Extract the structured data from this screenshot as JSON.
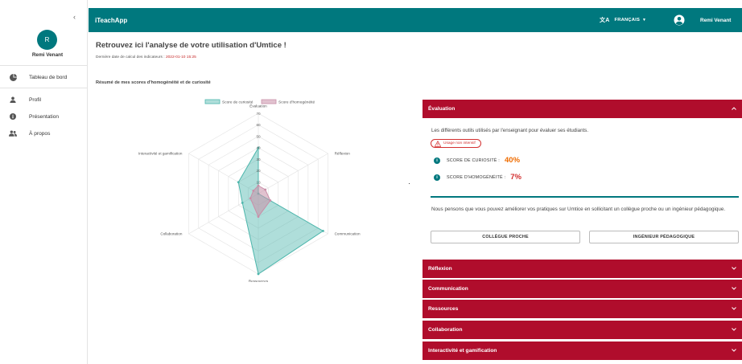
{
  "sidebar": {
    "user_initial": "R",
    "user_name": "Remi Venant",
    "items": [
      {
        "label": "Tableau de bord",
        "icon": "dashboard-icon"
      },
      {
        "label": "Profil",
        "icon": "person-icon"
      },
      {
        "label": "Présentation",
        "icon": "info-icon"
      },
      {
        "label": "À propos",
        "icon": "people-icon"
      }
    ]
  },
  "header": {
    "title": "iTeachApp",
    "language": "FRANÇAIS",
    "user": "Remi Venant"
  },
  "main": {
    "title": "Retrouvez ici l'analyse de votre utilisation d'Umtice !",
    "calc_label": "Dernière date de calcul des indicateurs : ",
    "calc_date": "2022-01-10 15:25",
    "summary_title": "Résumé de mes scores d'homogénéité et de curiosité"
  },
  "chart_data": {
    "type": "radar",
    "title": "",
    "legend": [
      "Score de curiosité",
      "Score d'homogénéité"
    ],
    "legend_position": "top",
    "axes": [
      "Évaluation",
      "Réflexion",
      "Communication",
      "Ressources",
      "Collaboration",
      "Interactivité et gamification"
    ],
    "ticks": [
      "70",
      "60",
      "50",
      "40",
      "30",
      "20",
      "10"
    ],
    "range": [
      0,
      70
    ],
    "series": [
      {
        "name": "Score de curiosité",
        "values": [
          40,
          0,
          65,
          70,
          16,
          20
        ],
        "color": "#4db6ac"
      },
      {
        "name": "Score d'homogénéité",
        "values": [
          7,
          7,
          12,
          20,
          8,
          5
        ],
        "color": "#c98fa8"
      }
    ]
  },
  "evaluation": {
    "title": "Évaluation",
    "description": "Les différents outils utilisés par l'enseignant pour évaluer ses étudiants.",
    "badge": "Usage non intensif",
    "curiosity_label": "SCORE DE CURIOSITÉ :",
    "curiosity_value": "40%",
    "homogeneity_label": "SCORE D'HOMOGÉNÉITÉ :",
    "homogeneity_value": "7%",
    "advice": "Nous pensons que vous pouvez améliorer vos pratiques sur Umtice en sollicitant un collègue proche ou un ingénieur pédagogique.",
    "btn_colleague": "COLLÈGUE PROCHE",
    "btn_engineer": "INGÉNIEUR PÉDAGOGIQUE"
  },
  "sections": [
    "Réflexion",
    "Communication",
    "Ressources",
    "Collaboration",
    "Interactivité et gamification"
  ],
  "colors": {
    "primary": "#00787e",
    "accordion": "#b00d2c",
    "curiosity_value": "#ef6c00",
    "homogeneity_value": "#d32f2f"
  }
}
